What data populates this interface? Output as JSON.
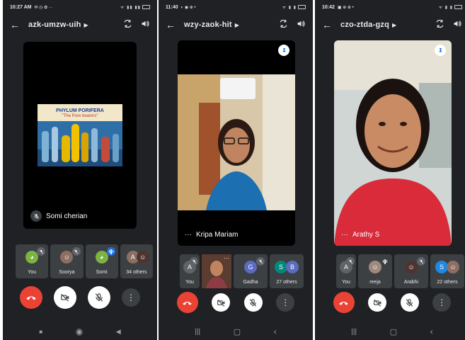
{
  "phones": [
    {
      "status_time": "10:27 AM",
      "meeting_code": "azk-umzw-uih",
      "main_name": "Somi cherian",
      "slide": {
        "title": "PHYLUM PORIFERA",
        "subtitle": "\"The Pore bearers\""
      },
      "participants": [
        {
          "label": "You",
          "initial": "",
          "color": "#7cb342"
        },
        {
          "label": "Soorya",
          "initial": "",
          "color": "#8d6e63"
        },
        {
          "label": "Somi",
          "initial": "",
          "color": "#7cb342"
        },
        {
          "label": "34 others",
          "initial": "A",
          "color": "#5f6368"
        }
      ]
    },
    {
      "status_time": "11:40",
      "meeting_code": "wzy-zaok-hit",
      "main_name": "Kripa Mariam",
      "participants": [
        {
          "label": "You",
          "initial": "A",
          "color": "#5f6368"
        },
        {
          "label": "",
          "initial": "",
          "color": "#6d4c41"
        },
        {
          "label": "Gadha",
          "initial": "G",
          "color": "#5c6bc0"
        },
        {
          "label": "27 others",
          "initial": "S",
          "color": "#00897b"
        }
      ]
    },
    {
      "status_time": "10:42",
      "meeting_code": "czo-ztda-gzq",
      "main_name": "Arathy S",
      "participants": [
        {
          "label": "You",
          "initial": "A",
          "color": "#5f6368"
        },
        {
          "label": "reeja",
          "initial": "",
          "color": "#a1887f"
        },
        {
          "label": "Arabhi",
          "initial": "",
          "color": "#4e342e"
        },
        {
          "label": "22 others",
          "initial": "S",
          "color": "#1e88e5"
        }
      ]
    }
  ],
  "icons": [
    "back-arrow-icon",
    "switch-camera-icon",
    "speaker-icon",
    "mic-off-icon",
    "pin-icon",
    "end-call-icon",
    "camera-off-icon",
    "more-vert-icon"
  ],
  "colors": {
    "end_call": "#ea4335",
    "meet_bg": "#202124",
    "tile_bg": "#3c4043"
  }
}
